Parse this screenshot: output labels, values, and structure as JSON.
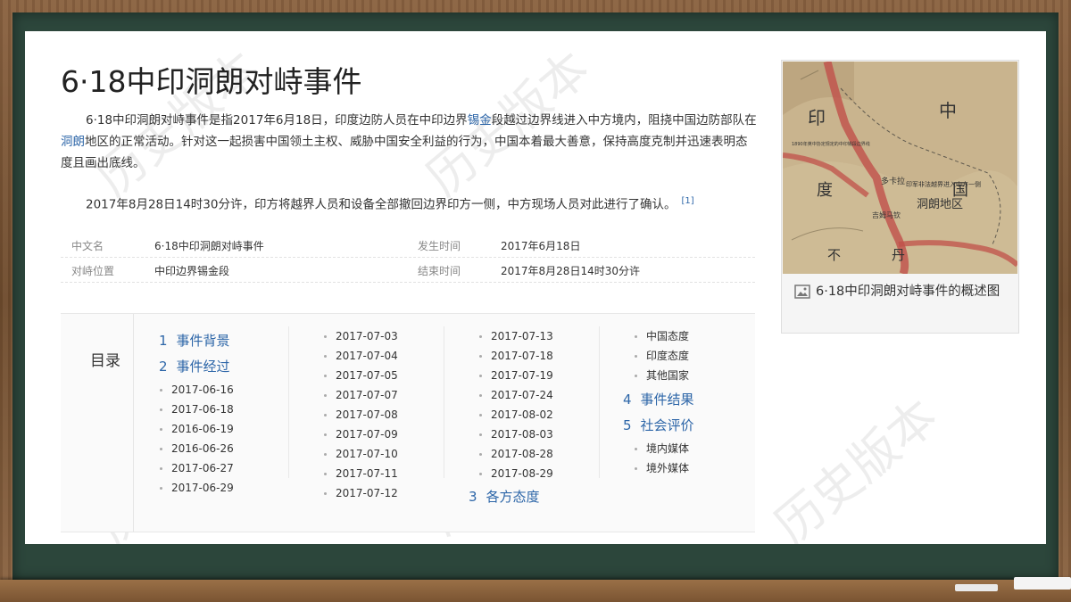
{
  "article": {
    "title": "6·18中印洞朗对峙事件",
    "intro": {
      "p1_a": "6·18中印洞朗对峙事件是指2017年6月18日，印度边防人员在中印边界",
      "p1_link1": "锡金",
      "p1_b": "段越过边界线进入中方境内，阻挠中国边防部队在",
      "p1_link2": "洞朗",
      "p1_c": "地区的正常活动。针对这一起损害中国领土主权、威胁中国安全利益的行为，中国本着最大善意，保持高度克制并迅速表明态度且画出底线。",
      "p2": "2017年8月28日14时30分许，印方将越界人员和设备全部撤回边界印方一侧，中方现场人员对此进行了确认。",
      "ref": "[1]"
    },
    "info": [
      {
        "k1": "中文名",
        "v1": "6·18中印洞朗对峙事件",
        "k2": "发生时间",
        "v2": "2017年6月18日"
      },
      {
        "k1": "对峙位置",
        "v1": "中印边界锡金段",
        "k2": "结束时间",
        "v2": "2017年8月28日14时30分许"
      }
    ]
  },
  "toc": {
    "label": "目录",
    "s1": {
      "num": "1",
      "label": "事件背景"
    },
    "s2": {
      "num": "2",
      "label": "事件经过"
    },
    "s2_items": [
      "2017-06-16",
      "2017-06-18",
      "2016-06-19",
      "2016-06-26",
      "2017-06-27",
      "2017-06-29"
    ],
    "col2_items": [
      "2017-07-03",
      "2017-07-04",
      "2017-07-05",
      "2017-07-07",
      "2017-07-08",
      "2017-07-09",
      "2017-07-10",
      "2017-07-11",
      "2017-07-12"
    ],
    "col3_items": [
      "2017-07-13",
      "2017-07-18",
      "2017-07-19",
      "2017-07-24",
      "2017-08-02",
      "2017-08-03",
      "2017-08-28",
      "2017-08-29"
    ],
    "s3": {
      "num": "3",
      "label": "各方态度"
    },
    "s3_items": [
      "中国态度",
      "印度态度",
      "其他国家"
    ],
    "s4": {
      "num": "4",
      "label": "事件结果"
    },
    "s5": {
      "num": "5",
      "label": "社会评价"
    },
    "s5_items": [
      "境内媒体",
      "境外媒体"
    ]
  },
  "figure": {
    "caption": "6·18中印洞朗对峙事件的概述图",
    "map_labels": [
      "印",
      "中",
      "度",
      "国",
      "不",
      "丹",
      "洞朗地区",
      "多卡拉",
      "印军非法越界进入中方一侧",
      "吉姆马钦",
      "1890年英中协定规定的中印锡段边界线"
    ]
  },
  "watermark": "历史版本"
}
